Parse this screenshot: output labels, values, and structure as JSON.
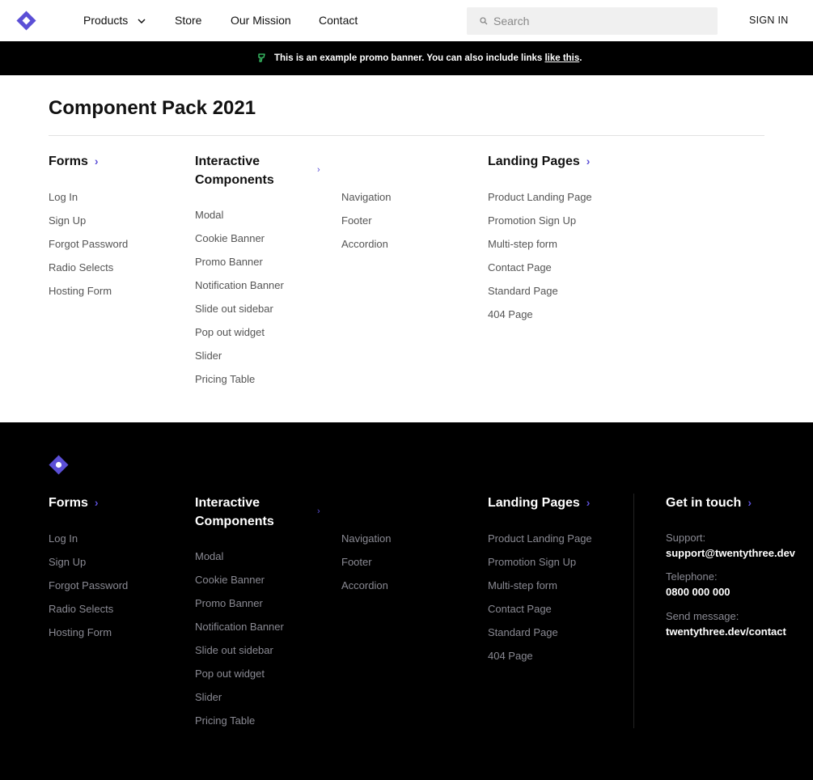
{
  "nav": {
    "links": [
      "Products",
      "Store",
      "Our Mission",
      "Contact"
    ],
    "search_placeholder": "Search",
    "sign_in": "SIGN IN"
  },
  "promo": {
    "text": "This is an example promo banner. You can also include links ",
    "link": "like this",
    "after": "."
  },
  "main": {
    "title": "Component Pack 2021"
  },
  "menu": {
    "forms": {
      "heading": "Forms",
      "items": [
        "Log In",
        "Sign Up",
        "Forgot Password",
        "Radio Selects",
        "Hosting Form"
      ]
    },
    "interactive": {
      "heading_line1": "Interactive",
      "heading_line2": "Components",
      "items": [
        "Modal",
        "Cookie Banner",
        "Promo Banner",
        "Notification Banner",
        "Slide out sidebar",
        "Pop out widget",
        "Slider",
        "Pricing Table"
      ],
      "items_col2": [
        "Navigation",
        "Footer",
        "Accordion"
      ]
    },
    "landing": {
      "heading": "Landing Pages",
      "items": [
        "Product Landing Page",
        "Promotion Sign Up",
        "Multi-step form",
        "Contact Page",
        "Standard Page",
        "404 Page"
      ]
    }
  },
  "footer": {
    "contact": {
      "heading": "Get in touch",
      "support_label": "Support:",
      "support_value": "support@twentythree.dev",
      "telephone_label": "Telephone:",
      "telephone_value": "0800 000 000",
      "message_label": "Send message:",
      "message_value": "twentythree.dev/contact"
    }
  },
  "colors": {
    "accent": "#5b4fd6",
    "promo_icon": "#3ecf6e",
    "footer_bg": "#000000"
  },
  "icons": [
    "diamond-logo-icon",
    "chevron-down-icon",
    "search-icon",
    "promo-leaf-icon",
    "chevron-right-icon"
  ]
}
